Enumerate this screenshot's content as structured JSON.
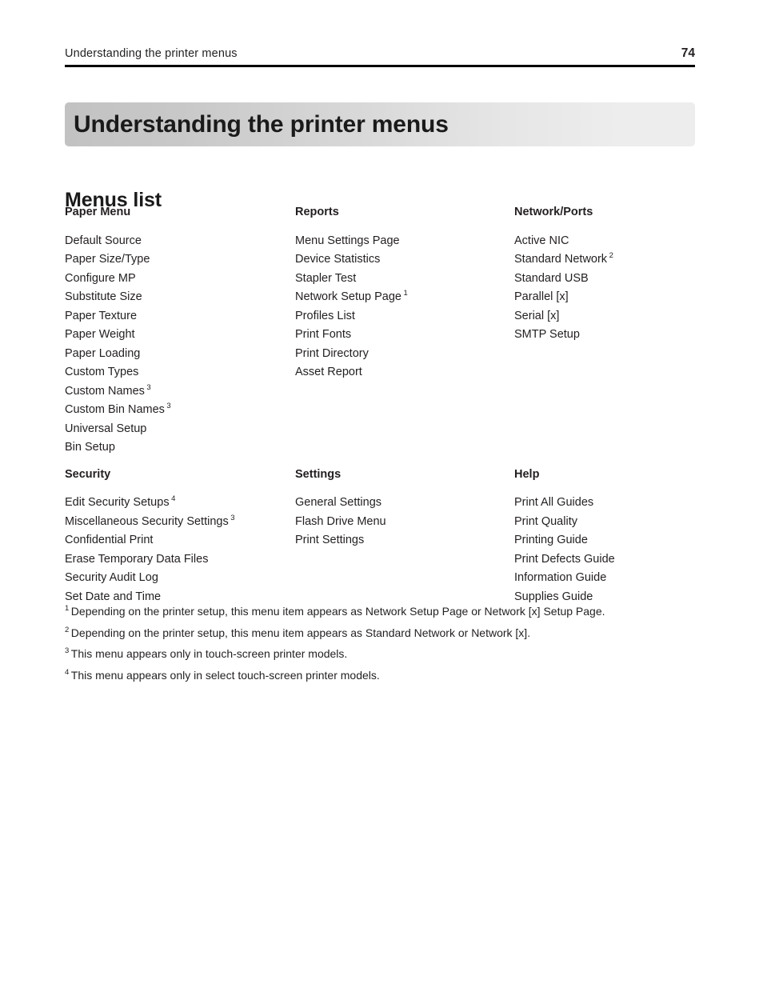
{
  "header": {
    "title": "Understanding the printer menus",
    "page_number": "74"
  },
  "chapter": {
    "title": "Understanding the printer menus"
  },
  "section": {
    "heading": "Menus list"
  },
  "menu_columns": [
    {
      "title": "Paper Menu",
      "items": [
        {
          "label": "Default Source",
          "note": ""
        },
        {
          "label": "Paper Size/Type",
          "note": ""
        },
        {
          "label": "Configure MP",
          "note": ""
        },
        {
          "label": "Substitute Size",
          "note": ""
        },
        {
          "label": "Paper Texture",
          "note": ""
        },
        {
          "label": "Paper Weight",
          "note": ""
        },
        {
          "label": "Paper Loading",
          "note": ""
        },
        {
          "label": "Custom Types",
          "note": ""
        },
        {
          "label": "Custom Names",
          "note": "3"
        },
        {
          "label": "Custom Bin Names",
          "note": "3"
        },
        {
          "label": "Universal Setup",
          "note": ""
        },
        {
          "label": "Bin Setup",
          "note": ""
        }
      ]
    },
    {
      "title": "Reports",
      "items": [
        {
          "label": "Menu Settings Page",
          "note": ""
        },
        {
          "label": "Device Statistics",
          "note": ""
        },
        {
          "label": "Stapler Test",
          "note": ""
        },
        {
          "label": "Network Setup Page",
          "note": "1"
        },
        {
          "label": "Profiles List",
          "note": ""
        },
        {
          "label": "Print Fonts",
          "note": ""
        },
        {
          "label": "Print Directory",
          "note": ""
        },
        {
          "label": "Asset Report",
          "note": ""
        }
      ]
    },
    {
      "title": "Network/Ports",
      "items": [
        {
          "label": "Active NIC",
          "note": ""
        },
        {
          "label": "Standard Network",
          "note": "2"
        },
        {
          "label": "Standard USB",
          "note": ""
        },
        {
          "label": "Parallel [x]",
          "note": ""
        },
        {
          "label": "Serial [x]",
          "note": ""
        },
        {
          "label": "SMTP Setup",
          "note": ""
        }
      ]
    },
    {
      "title": "Security",
      "items": [
        {
          "label": "Edit Security Setups",
          "note": "4"
        },
        {
          "label": "Miscellaneous Security Settings",
          "note": "3"
        },
        {
          "label": "Confidential Print",
          "note": ""
        },
        {
          "label": "Erase Temporary Data Files",
          "note": ""
        },
        {
          "label": "Security Audit Log",
          "note": ""
        },
        {
          "label": "Set Date and Time",
          "note": ""
        }
      ]
    },
    {
      "title": "Settings",
      "items": [
        {
          "label": "General Settings",
          "note": ""
        },
        {
          "label": "Flash Drive Menu",
          "note": ""
        },
        {
          "label": "Print Settings",
          "note": ""
        }
      ]
    },
    {
      "title": "Help",
      "items": [
        {
          "label": "Print All Guides",
          "note": ""
        },
        {
          "label": "Print Quality",
          "note": ""
        },
        {
          "label": "Printing Guide",
          "note": ""
        },
        {
          "label": "Print Defects Guide",
          "note": ""
        },
        {
          "label": "Information Guide",
          "note": ""
        },
        {
          "label": "Supplies Guide",
          "note": ""
        }
      ]
    }
  ],
  "footnotes": [
    {
      "marker": "1",
      "text": "Depending on the printer setup, this menu item appears as Network Setup Page or Network [x] Setup Page."
    },
    {
      "marker": "2",
      "text": "Depending on the printer setup, this menu item appears as Standard Network or Network [x]."
    },
    {
      "marker": "3",
      "text": "This menu appears only in touch-screen printer models."
    },
    {
      "marker": "4",
      "text": "This menu appears only in select touch-screen printer models."
    }
  ]
}
